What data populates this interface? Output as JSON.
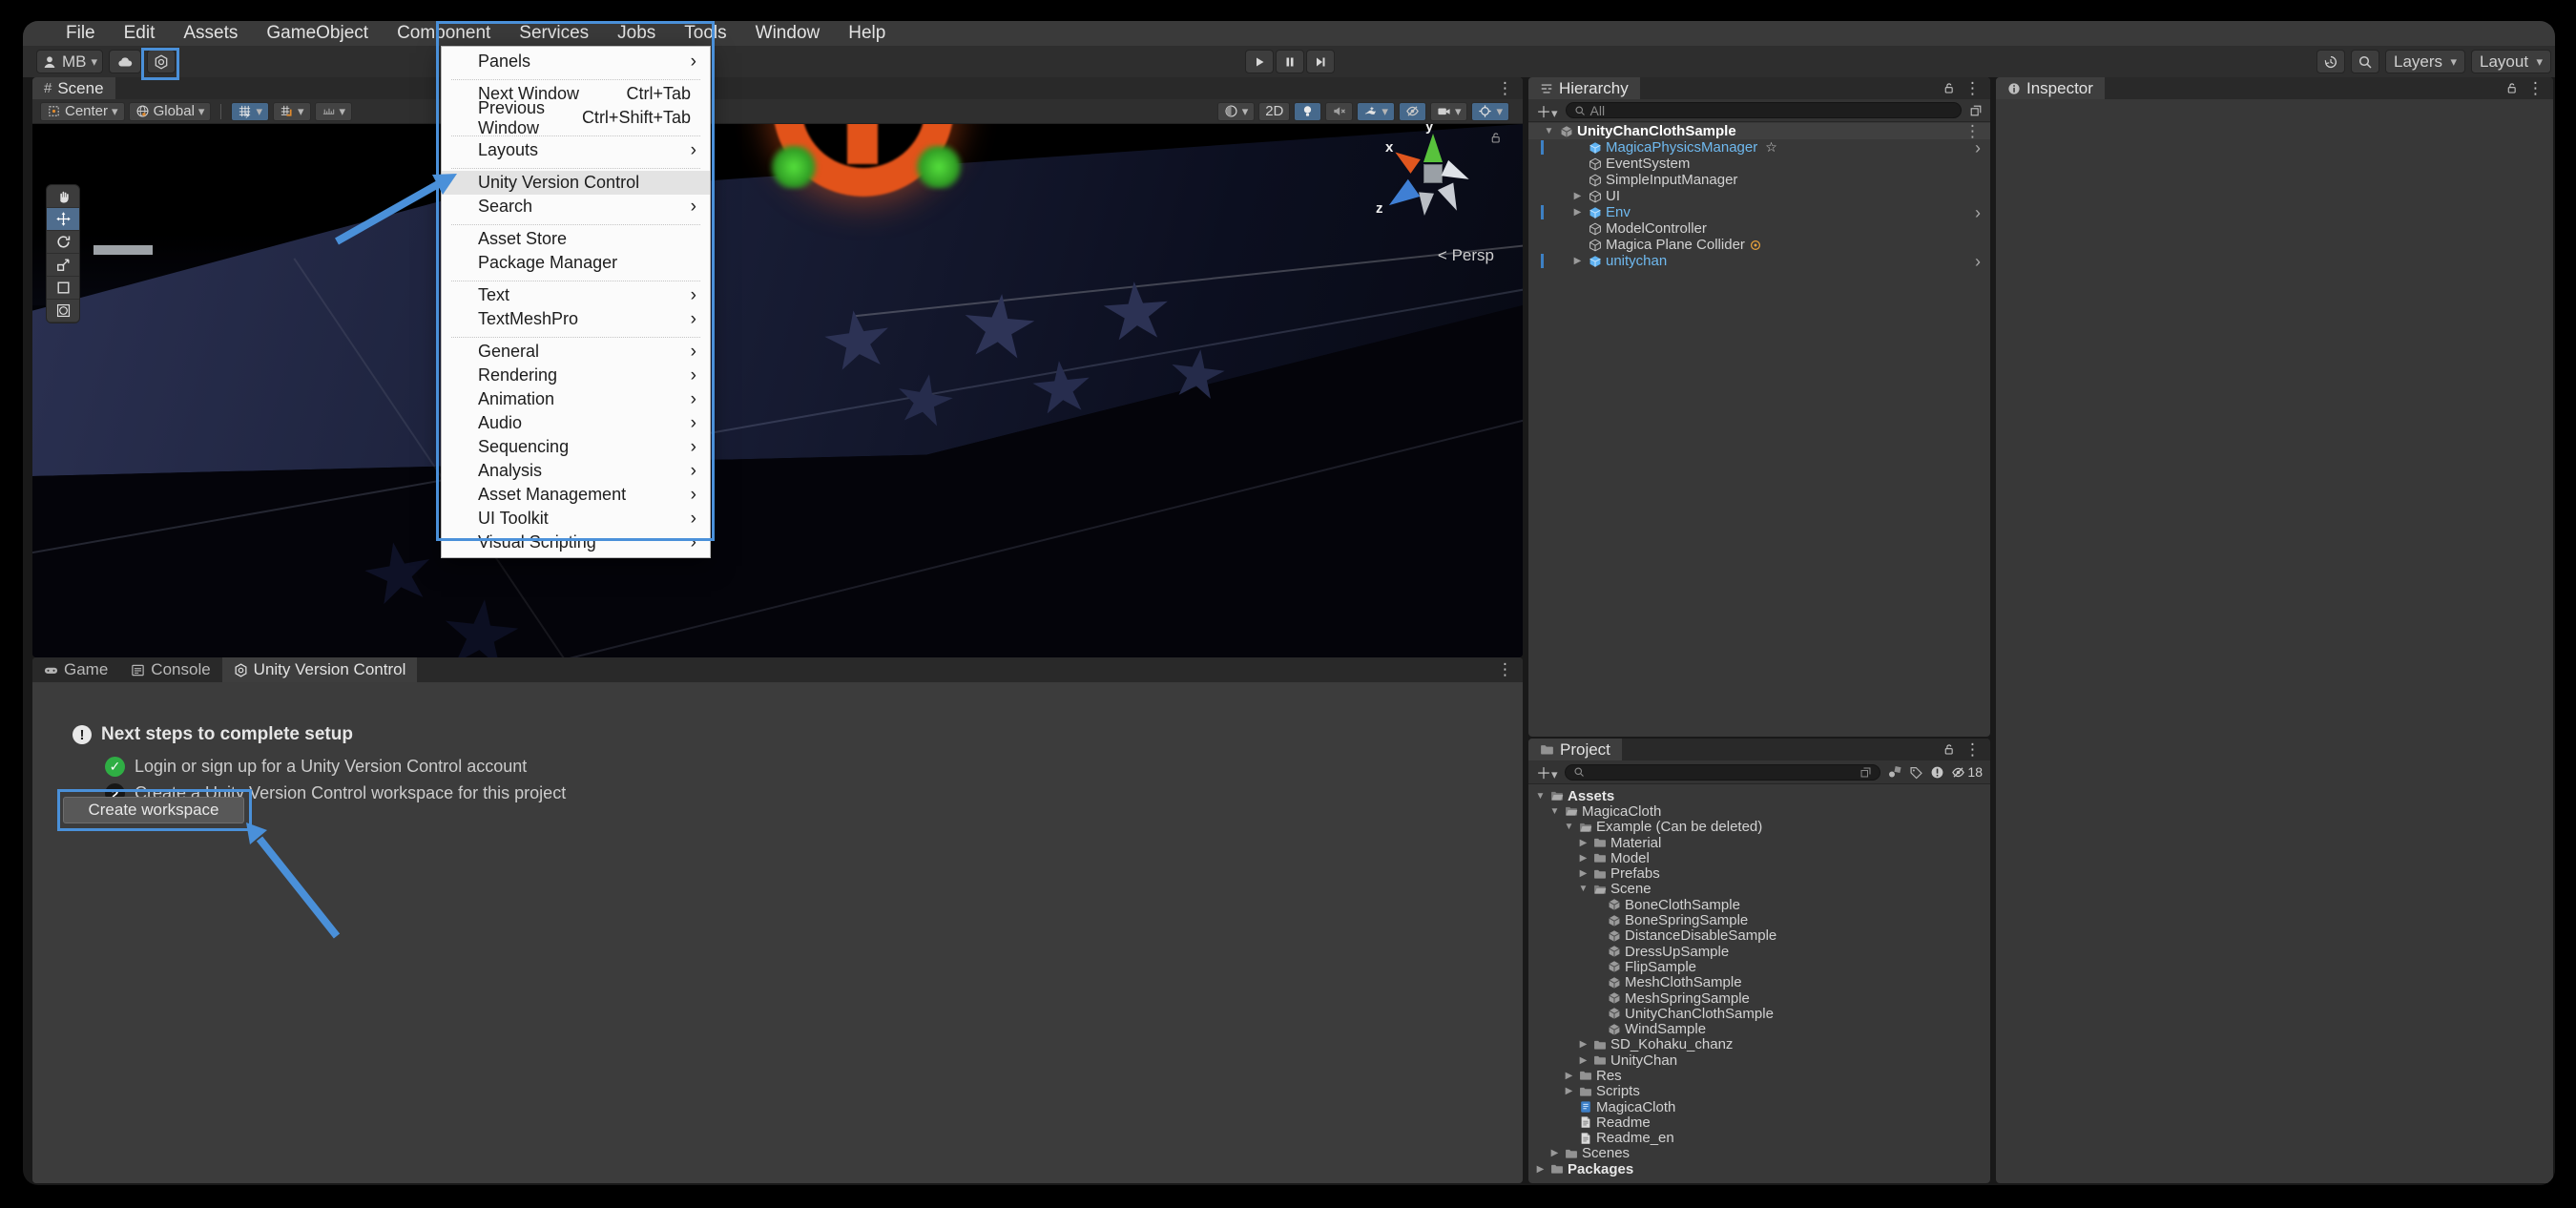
{
  "annotation_color": "#4a90d9",
  "menu_bar": {
    "items": [
      {
        "label": "File"
      },
      {
        "label": "Edit"
      },
      {
        "label": "Assets"
      },
      {
        "label": "GameObject"
      },
      {
        "label": "Component"
      },
      {
        "label": "Services"
      },
      {
        "label": "Jobs"
      },
      {
        "label": "Tools"
      },
      {
        "label": "Window",
        "active": true
      },
      {
        "label": "Help"
      }
    ]
  },
  "window_menu": {
    "items": [
      {
        "label": "Panels",
        "submenu": true,
        "sep": true
      },
      {
        "label": "Next Window",
        "shortcut": "Ctrl+Tab"
      },
      {
        "label": "Previous Window",
        "shortcut": "Ctrl+Shift+Tab",
        "sep": true
      },
      {
        "label": "Layouts",
        "submenu": true,
        "sep": true
      },
      {
        "label": "Unity Version Control",
        "highlighted": true
      },
      {
        "label": "Search",
        "submenu": true,
        "sep": true
      },
      {
        "label": "Asset Store"
      },
      {
        "label": "Package Manager",
        "sep": true
      },
      {
        "label": "Text",
        "submenu": true
      },
      {
        "label": "TextMeshPro",
        "submenu": true,
        "sep": true
      },
      {
        "label": "General",
        "submenu": true
      },
      {
        "label": "Rendering",
        "submenu": true
      },
      {
        "label": "Animation",
        "submenu": true
      },
      {
        "label": "Audio",
        "submenu": true
      },
      {
        "label": "Sequencing",
        "submenu": true
      },
      {
        "label": "Analysis",
        "submenu": true
      },
      {
        "label": "Asset Management",
        "submenu": true
      },
      {
        "label": "UI Toolkit",
        "submenu": true
      },
      {
        "label": "Visual Scripting",
        "submenu": true
      }
    ]
  },
  "top_toolbar": {
    "account_label": "MB",
    "left_icons": [
      "avatar-icon",
      "cloud-icon",
      "version-control-icon"
    ],
    "play_controls": [
      "play-icon",
      "pause-icon",
      "step-icon"
    ],
    "right": {
      "history_icon": "history-icon",
      "search_icon": "search-icon",
      "layers_label": "Layers",
      "layout_label": "Layout"
    }
  },
  "scene": {
    "tab": "Scene",
    "toolbar_left": [
      {
        "icon": "center-pivot-icon",
        "label": "Center",
        "caret": true
      },
      {
        "icon": "globe-icon",
        "label": "Global",
        "caret": true
      },
      {
        "separator": true
      },
      {
        "icon": "snap-grid-icon",
        "active": true,
        "caret": true
      },
      {
        "icon": "snap-move-icon",
        "caret": true
      },
      {
        "icon": "snap-increment-icon",
        "caret": true
      }
    ],
    "toolbar_right": [
      {
        "icon": "render-sphere-icon",
        "caret": true
      },
      {
        "label": "2D"
      },
      {
        "icon": "bulb-icon",
        "active": true
      },
      {
        "icon": "audio-muted-icon"
      },
      {
        "icon": "fx-icon",
        "active": true,
        "caret": true
      },
      {
        "icon": "eye-off-icon",
        "active": true
      },
      {
        "icon": "camera-icon",
        "caret": true
      },
      {
        "icon": "gizmo-target-icon",
        "active": true,
        "caret": true
      }
    ],
    "tools": [
      {
        "icon": "hand-tool-icon"
      },
      {
        "icon": "move-tool-icon",
        "active": true
      },
      {
        "icon": "rotate-tool-icon"
      },
      {
        "icon": "scale-tool-icon"
      },
      {
        "icon": "rect-tool-icon"
      },
      {
        "icon": "transform-tool-icon"
      }
    ],
    "gizmo_axes": {
      "x": "x",
      "y": "y",
      "z": "z"
    },
    "camera_label": "Persp"
  },
  "hierarchy": {
    "title": "Hierarchy",
    "search_placeholder": "All",
    "rows": [
      {
        "label": "UnityChanClothSample",
        "icon": "unity-scene-icon",
        "kind": "scene",
        "expand": "open",
        "kebab": true
      },
      {
        "label": "MagicaPhysicsManager",
        "icon": "prefab-cube-icon",
        "prefab": true,
        "star": true,
        "chevron": true,
        "track": true
      },
      {
        "label": "EventSystem",
        "icon": "gameobject-cube-icon"
      },
      {
        "label": "SimpleInputManager",
        "icon": "gameobject-cube-icon"
      },
      {
        "label": "UI",
        "icon": "gameobject-cube-icon",
        "expand": "closed"
      },
      {
        "label": "Env",
        "icon": "prefab-cube-icon",
        "prefab": true,
        "expand": "closed",
        "chevron": true,
        "track": true
      },
      {
        "label": "ModelController",
        "icon": "gameobject-cube-icon"
      },
      {
        "label": "Magica Plane Collider",
        "icon": "gameobject-cube-icon",
        "badge": "override-badge-icon"
      },
      {
        "label": "unitychan",
        "icon": "prefab-cube-icon",
        "prefab": true,
        "expand": "closed",
        "chevron": true,
        "track": true
      }
    ]
  },
  "inspector": {
    "title": "Inspector"
  },
  "project": {
    "title": "Project",
    "hidden_count": "18",
    "toolbar_icons": [
      "open-new-icon",
      "package-filter-icon",
      "tag-icon",
      "alert-icon",
      "eye-off-icon"
    ],
    "rows": [
      {
        "label": "Assets",
        "depth": 0,
        "icon": "folder-open-icon",
        "expand": "open",
        "bold": true
      },
      {
        "label": "MagicaCloth",
        "depth": 1,
        "icon": "folder-open-icon",
        "expand": "open"
      },
      {
        "label": "Example (Can be deleted)",
        "depth": 2,
        "icon": "folder-open-icon",
        "expand": "open"
      },
      {
        "label": "Material",
        "depth": 3,
        "icon": "folder-icon",
        "expand": "closed"
      },
      {
        "label": "Model",
        "depth": 3,
        "icon": "folder-icon",
        "expand": "closed"
      },
      {
        "label": "Prefabs",
        "depth": 3,
        "icon": "folder-icon",
        "expand": "closed"
      },
      {
        "label": "Scene",
        "depth": 3,
        "icon": "folder-open-icon",
        "expand": "open"
      },
      {
        "label": "BoneClothSample",
        "depth": 4,
        "icon": "unity-scene-icon"
      },
      {
        "label": "BoneSpringSample",
        "depth": 4,
        "icon": "unity-scene-icon"
      },
      {
        "label": "DistanceDisableSample",
        "depth": 4,
        "icon": "unity-scene-icon"
      },
      {
        "label": "DressUpSample",
        "depth": 4,
        "icon": "unity-scene-icon"
      },
      {
        "label": "FlipSample",
        "depth": 4,
        "icon": "unity-scene-icon"
      },
      {
        "label": "MeshClothSample",
        "depth": 4,
        "icon": "unity-scene-icon"
      },
      {
        "label": "MeshSpringSample",
        "depth": 4,
        "icon": "unity-scene-icon"
      },
      {
        "label": "UnityChanClothSample",
        "depth": 4,
        "icon": "unity-scene-icon"
      },
      {
        "label": "WindSample",
        "depth": 4,
        "icon": "unity-scene-icon"
      },
      {
        "label": "SD_Kohaku_chanz",
        "depth": 3,
        "icon": "folder-icon",
        "expand": "closed"
      },
      {
        "label": "UnityChan",
        "depth": 3,
        "icon": "folder-icon",
        "expand": "closed"
      },
      {
        "label": "Res",
        "depth": 2,
        "icon": "folder-icon",
        "expand": "closed"
      },
      {
        "label": "Scripts",
        "depth": 2,
        "icon": "folder-icon",
        "expand": "closed"
      },
      {
        "label": "MagicaCloth",
        "depth": 2,
        "icon": "asset-blue-icon"
      },
      {
        "label": "Readme",
        "depth": 2,
        "icon": "doc-icon"
      },
      {
        "label": "Readme_en",
        "depth": 2,
        "icon": "doc-icon"
      },
      {
        "label": "Scenes",
        "depth": 1,
        "icon": "folder-icon",
        "expand": "closed"
      },
      {
        "label": "Packages",
        "depth": 0,
        "icon": "folder-icon",
        "expand": "closed",
        "bold": true
      }
    ]
  },
  "bottom": {
    "tabs": [
      {
        "label": "Game",
        "icon": "gamepad-icon"
      },
      {
        "label": "Console",
        "icon": "console-icon"
      },
      {
        "label": "Unity Version Control",
        "icon": "uvc-icon",
        "active": true
      }
    ],
    "setup_title": "Next steps to complete setup",
    "steps": [
      {
        "state": "done",
        "text": "Login or sign up for a Unity Version Control account"
      },
      {
        "state": "2",
        "text": "Create a Unity Version Control workspace for this project"
      }
    ],
    "create_button": "Create workspace"
  }
}
